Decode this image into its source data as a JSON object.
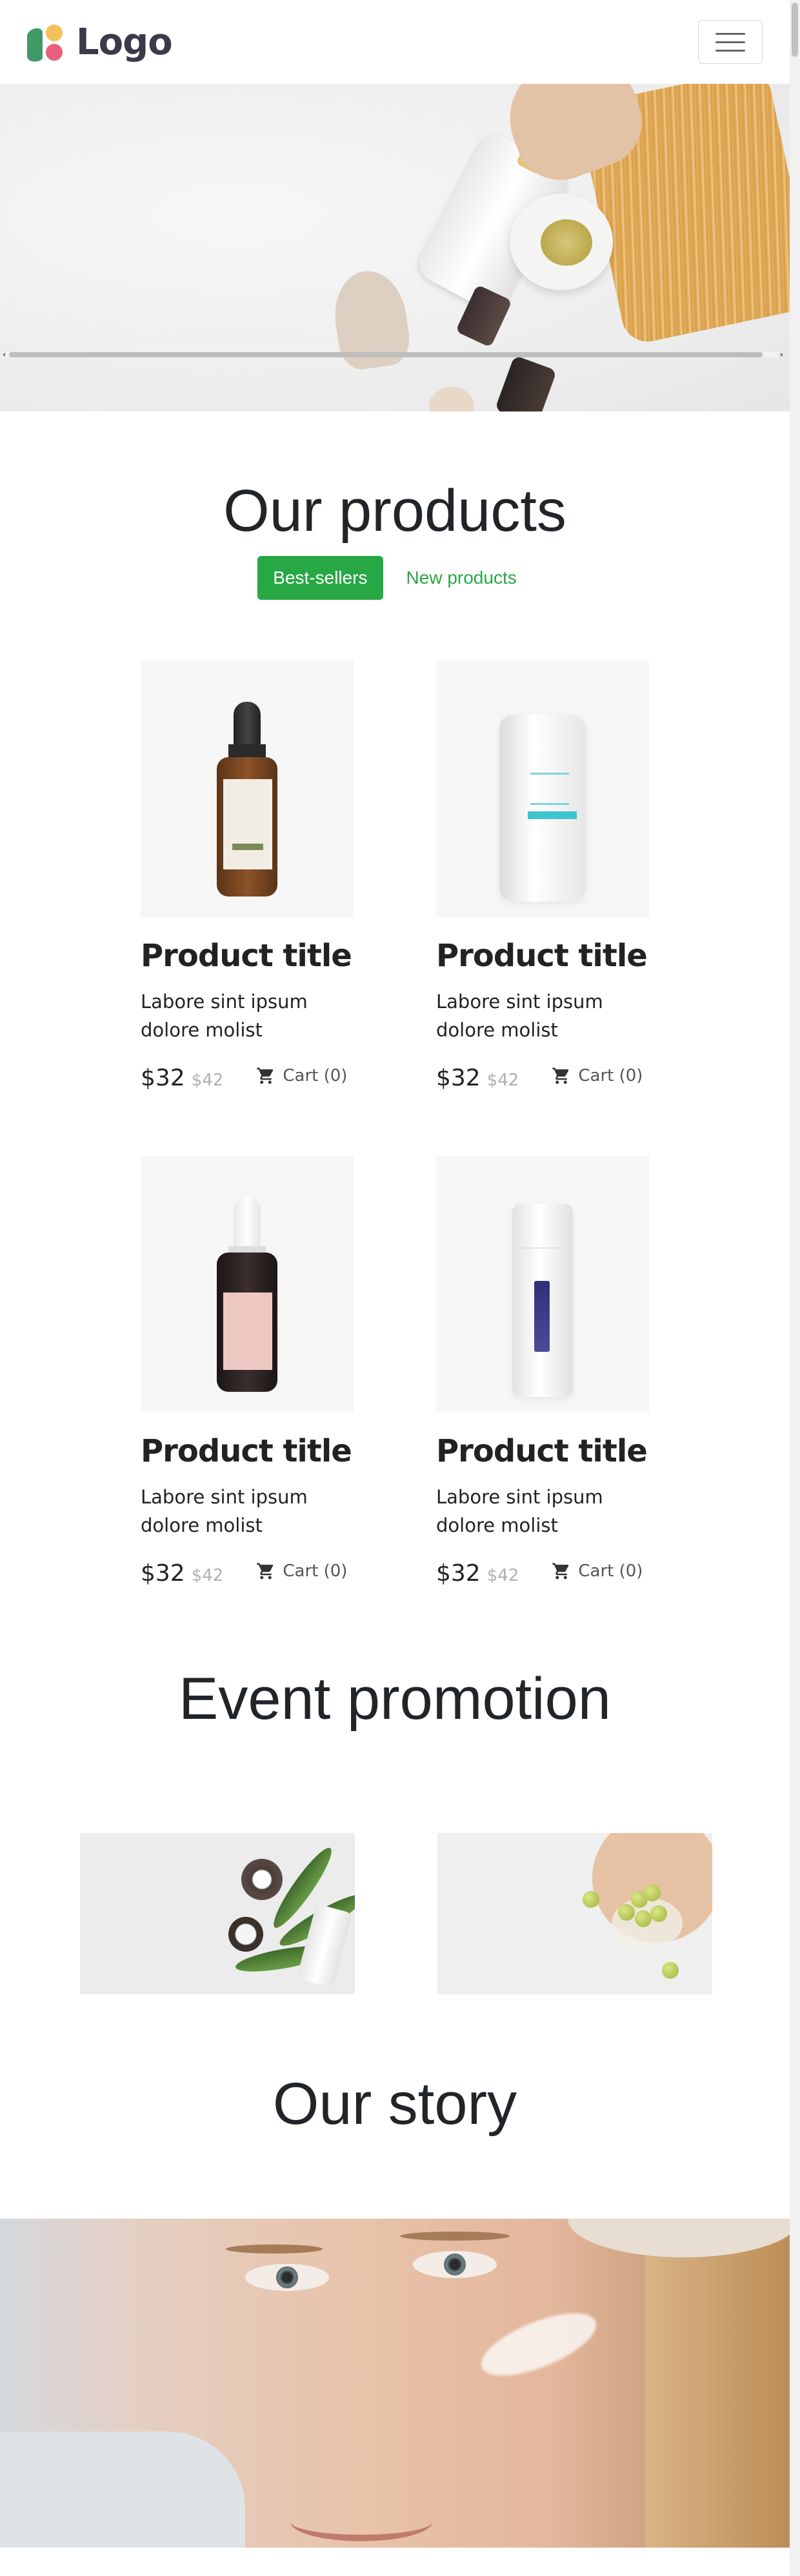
{
  "header": {
    "logo_text": "Logo",
    "logo_colors": [
      "#3f9a68",
      "#f4c25c",
      "#e95f7d"
    ],
    "menu_icon": "hamburger-icon"
  },
  "products": {
    "title": "Our products",
    "tabs": [
      {
        "label": "Best-sellers",
        "active": true
      },
      {
        "label": "New products",
        "active": false
      }
    ],
    "items": [
      {
        "title": "Product title",
        "description": "Labore sint ipsum dolore molist",
        "price": "$32",
        "old_price": "$42",
        "cart_label": "Cart (0)",
        "image": "amber-dropper-bottle"
      },
      {
        "title": "Product title",
        "description": "Labore sint ipsum dolore molist",
        "price": "$32",
        "old_price": "$42",
        "cart_label": "Cart (0)",
        "image": "white-cream-jar"
      },
      {
        "title": "Product title",
        "description": "Labore sint ipsum dolore molist",
        "price": "$32",
        "old_price": "$42",
        "cart_label": "Cart (0)",
        "image": "pink-label-dropper-bottle"
      },
      {
        "title": "Product title",
        "description": "Labore sint ipsum dolore molist",
        "price": "$32",
        "old_price": "$42",
        "cart_label": "Cart (0)",
        "image": "white-pump-bottle"
      }
    ]
  },
  "promotion": {
    "title": "Event promotion"
  },
  "story": {
    "title": "Our story"
  },
  "colors": {
    "accent": "#28a745",
    "text": "#212529",
    "muted_price": "#b0b0b0"
  }
}
